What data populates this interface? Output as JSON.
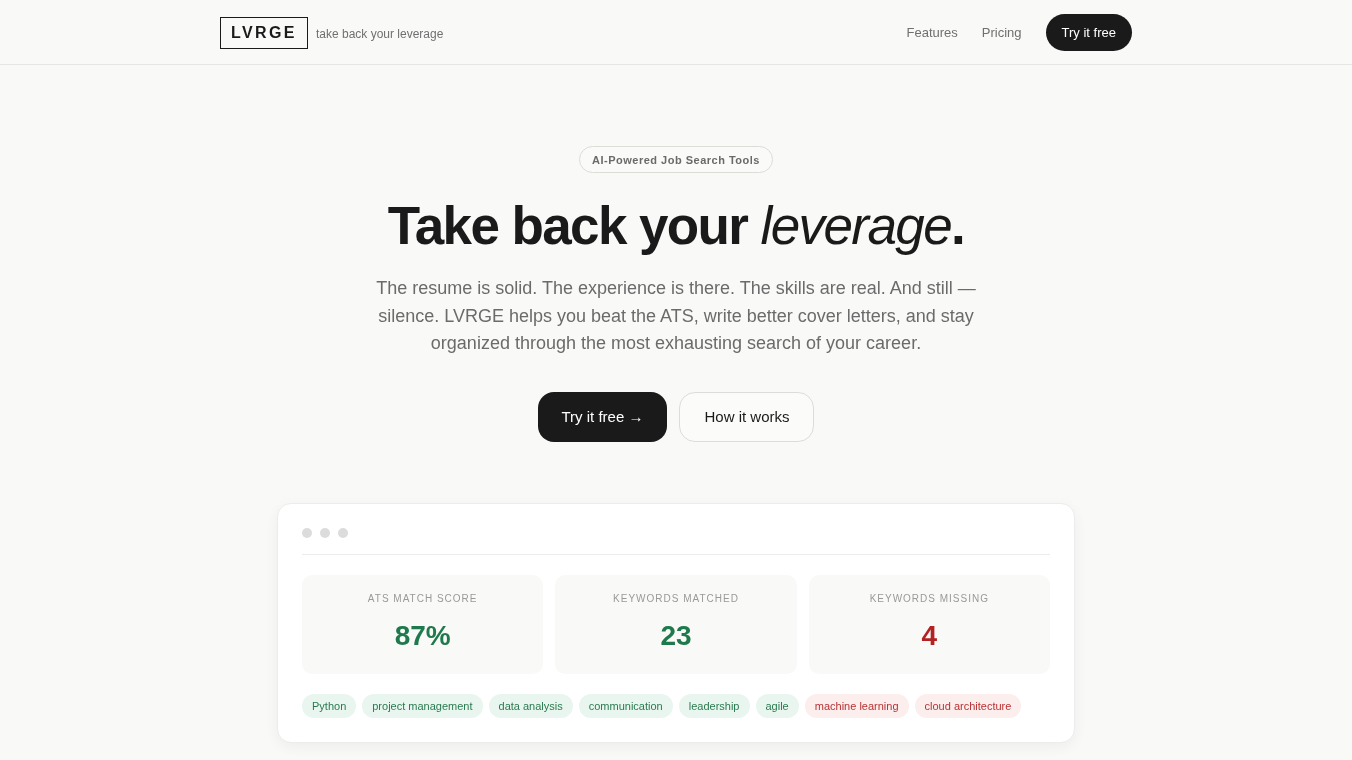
{
  "header": {
    "logo": "LVRGE",
    "tagline": "take back your leverage",
    "nav": [
      {
        "label": "Features",
        "kind": "link"
      },
      {
        "label": "Pricing",
        "kind": "link"
      },
      {
        "label": "Try it free",
        "kind": "button"
      }
    ]
  },
  "hero": {
    "badge": "AI-Powered Job Search Tools",
    "title": "Take back your *leverage*.",
    "description": "The resume is solid. The experience is there. The skills are real. And still — silence. LVRGE helps you beat the ATS, write better cover letters, and stay organized through the most exhausting search of your career.",
    "buttons": [
      {
        "label": "Try it free →",
        "kind": "primary"
      },
      {
        "label": "How it works",
        "kind": "secondary"
      }
    ]
  },
  "preview": {
    "stats": [
      {
        "label": "ATS MATCH SCORE",
        "value": "87%",
        "kind": "positive"
      },
      {
        "label": "KEYWORDS MATCHED",
        "value": "23",
        "kind": "positive"
      },
      {
        "label": "KEYWORDS MISSING",
        "value": "4",
        "kind": "negative"
      }
    ],
    "keywords": [
      {
        "label": "Python",
        "kind": "matched"
      },
      {
        "label": "project management",
        "kind": "matched"
      },
      {
        "label": "data analysis",
        "kind": "matched"
      },
      {
        "label": "communication",
        "kind": "matched"
      },
      {
        "label": "leadership",
        "kind": "matched"
      },
      {
        "label": "agile",
        "kind": "matched"
      },
      {
        "label": "machine learning",
        "kind": "missing"
      },
      {
        "label": "cloud architecture",
        "kind": "missing"
      }
    ]
  }
}
